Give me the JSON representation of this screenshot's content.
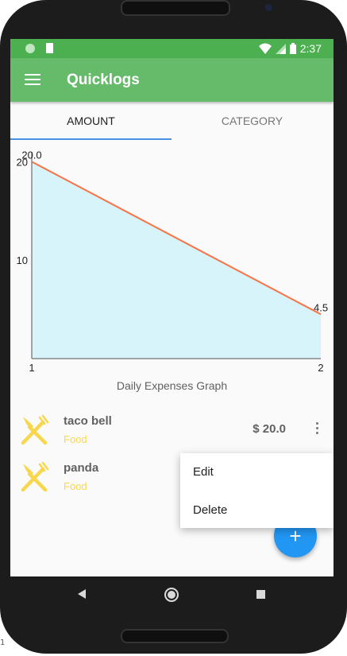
{
  "status_bar": {
    "time": "2:37",
    "icons": [
      "notification-circle-icon",
      "sd-card-icon",
      "wifi-icon",
      "signal-icon",
      "battery-icon"
    ]
  },
  "app_bar": {
    "title": "Quicklogs",
    "menu_icon": "hamburger-menu-icon"
  },
  "tabs": [
    {
      "label": "AMOUNT",
      "selected": true
    },
    {
      "label": "CATEGORY",
      "selected": false
    }
  ],
  "chart_data": {
    "type": "area",
    "title": "Daily Expenses Graph",
    "x": [
      1,
      2
    ],
    "values": [
      20.0,
      4.5
    ],
    "value_labels": [
      "20.0",
      "4.5"
    ],
    "x_tick_labels": [
      "1",
      "2"
    ],
    "y_tick_labels": [
      "20",
      "10"
    ],
    "xlim": [
      1,
      2
    ],
    "ylim": [
      0,
      21
    ],
    "line_color": "#ff7043",
    "fill_color": "#d7f4fb",
    "grid": false,
    "legend": "none"
  },
  "expenses": [
    {
      "name": "taco bell",
      "category": "Food",
      "amount": "$ 20.0",
      "icon": "fork-knife-icon"
    },
    {
      "name": "panda",
      "category": "Food",
      "amount": "",
      "icon": "fork-knife-icon"
    }
  ],
  "popup_menu": {
    "items": [
      "Edit",
      "Delete"
    ]
  },
  "fab": {
    "label": "+",
    "icon": "add-icon"
  },
  "nav_bar": {
    "icons": [
      "back-icon",
      "home-icon",
      "recents-icon"
    ]
  },
  "footer_text": "1",
  "colors": {
    "status_bar": "#4caf50",
    "app_bar": "#66bb6a",
    "tab_indicator": "#4a90e2",
    "category_text": "#f9d74c",
    "fab": "#2196f3",
    "icon_yellow": "#f9d74c"
  }
}
